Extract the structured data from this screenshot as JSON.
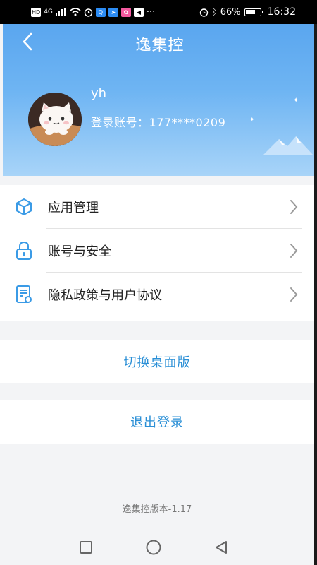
{
  "status_bar": {
    "left_indicators": [
      "HD",
      "4G"
    ],
    "time": "16:32",
    "battery": "66%"
  },
  "header": {
    "title": "逸集控",
    "username": "yh",
    "account_label": "登录账号：",
    "account_value": "177****0209"
  },
  "menu": {
    "items": [
      {
        "label": "应用管理",
        "icon": "cube-icon"
      },
      {
        "label": "账号与安全",
        "icon": "lock-icon"
      },
      {
        "label": "隐私政策与用户协议",
        "icon": "document-icon"
      }
    ]
  },
  "actions": {
    "switch_desktop": "切换桌面版",
    "logout": "退出登录"
  },
  "footer": {
    "version": "逸集控版本-1.17"
  },
  "colors": {
    "accent": "#2a8fd6",
    "header_top": "#5aa6ef",
    "icon_blue": "#3b9be6"
  }
}
